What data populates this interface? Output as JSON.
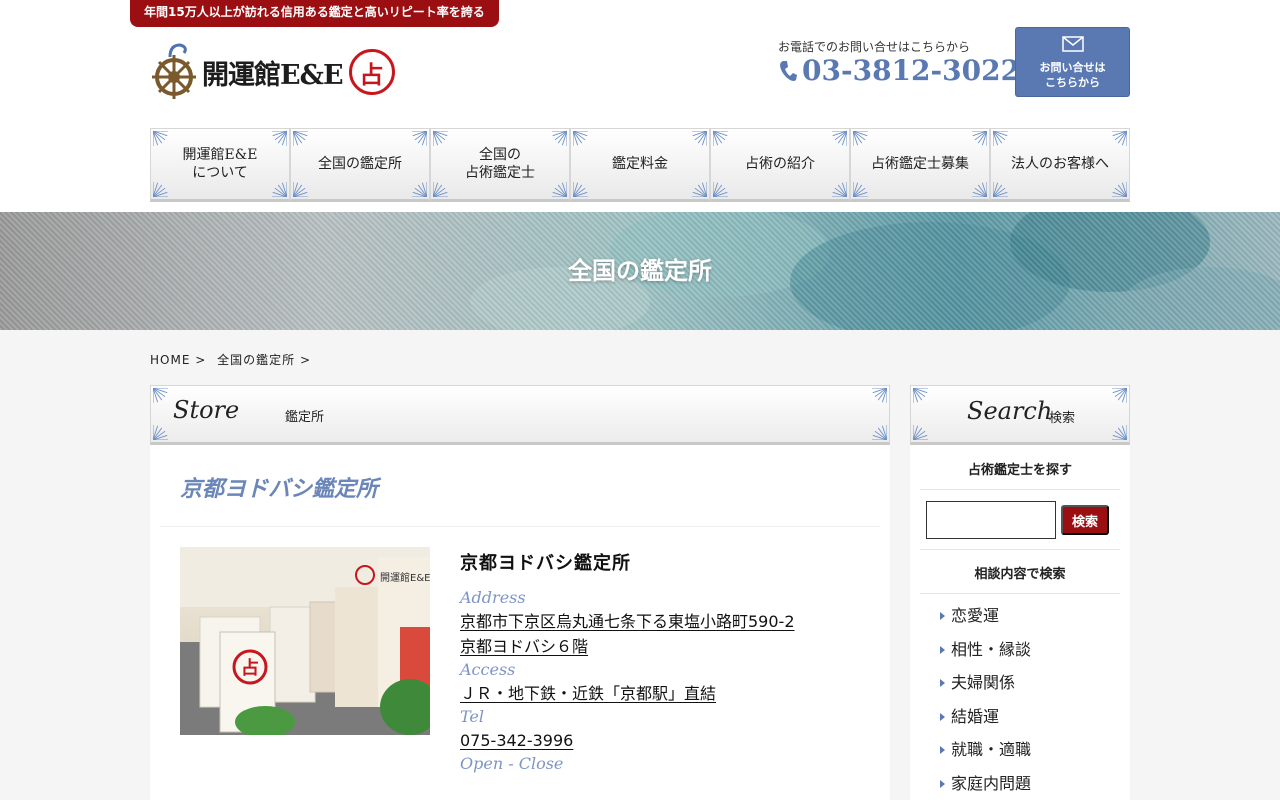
{
  "header": {
    "tagline": "年間15万人以上が訪れる信用ある鑑定と高いリピート率を誇る",
    "logo_text": "開運館E&E",
    "logo_seal": "占",
    "phone_caption": "お電話でのお問い合せはこちらから",
    "phone_number": "03-3812-3022",
    "contact_line1": "お問い合せは",
    "contact_line2": "こちらから"
  },
  "nav": [
    {
      "label": "開運館E&E\nについて"
    },
    {
      "label": "全国の鑑定所"
    },
    {
      "label": "全国の\n占術鑑定士"
    },
    {
      "label": "鑑定料金"
    },
    {
      "label": "占術の紹介"
    },
    {
      "label": "占術鑑定士募集"
    },
    {
      "label": "法人のお客様へ"
    }
  ],
  "hero": {
    "title": "全国の鑑定所"
  },
  "breadcrumb": {
    "home": "HOME",
    "sep1": ">",
    "current": "全国の鑑定所",
    "sep2": ">"
  },
  "main": {
    "head_en": "Store",
    "head_ja": "鑑定所",
    "store_title": "京都ヨドバシ鑑定所",
    "photo_seal": "占",
    "photo_sign": "開運館E&E",
    "store_name": "京都ヨドバシ鑑定所",
    "address_label": "Address",
    "address_line1": "京都市下京区烏丸通七条下る東塩小路町590-2",
    "address_line2": "京都ヨドバシ６階",
    "access_label": "Access",
    "access": "ＪＲ・地下鉄・近鉄「京都駅」直結",
    "tel_label": "Tel",
    "tel": "075-342-3996",
    "open_label": "Open - Close"
  },
  "sidebar": {
    "head_en": "Search",
    "head_ja": "検索",
    "find_title": "占術鑑定士を探す",
    "search_button": "検索",
    "search_value": "",
    "consult_title": "相談内容で検索",
    "categories": [
      "恋愛運",
      "相性・縁談",
      "夫婦関係",
      "結婚運",
      "就職・適職",
      "家庭内問題"
    ]
  },
  "colors": {
    "brand_red": "#9b0e12",
    "accent_blue": "#5a79b3",
    "label_blue": "#7d95c4"
  }
}
